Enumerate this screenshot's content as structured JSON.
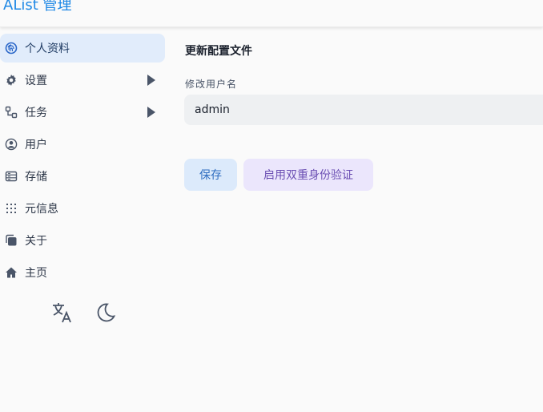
{
  "header": {
    "brand": "AList 管理"
  },
  "sidebar": {
    "items": [
      {
        "label": "个人资料",
        "icon": "fingerprint-icon",
        "active": true
      },
      {
        "label": "设置",
        "icon": "gear-icon",
        "has_submenu": true
      },
      {
        "label": "任务",
        "icon": "workflow-icon",
        "has_submenu": true
      },
      {
        "label": "用户",
        "icon": "user-circle-icon"
      },
      {
        "label": "存储",
        "icon": "database-icon"
      },
      {
        "label": "元信息",
        "icon": "grid-dots-icon"
      },
      {
        "label": "关于",
        "icon": "copy-icon"
      },
      {
        "label": "主页",
        "icon": "home-icon"
      }
    ],
    "tools": [
      "translate-icon",
      "moon-icon"
    ]
  },
  "main": {
    "section_title": "更新配置文件",
    "username_label": "修改用户名",
    "username_value": "admin",
    "save_button": "保存",
    "enable_2fa_button": "启用双重身份验证"
  },
  "colors": {
    "accent": "#1e88e5",
    "active_bg": "#e1ecfb",
    "save_bg": "#dceafb",
    "twofa_bg": "#ebe6fc"
  }
}
